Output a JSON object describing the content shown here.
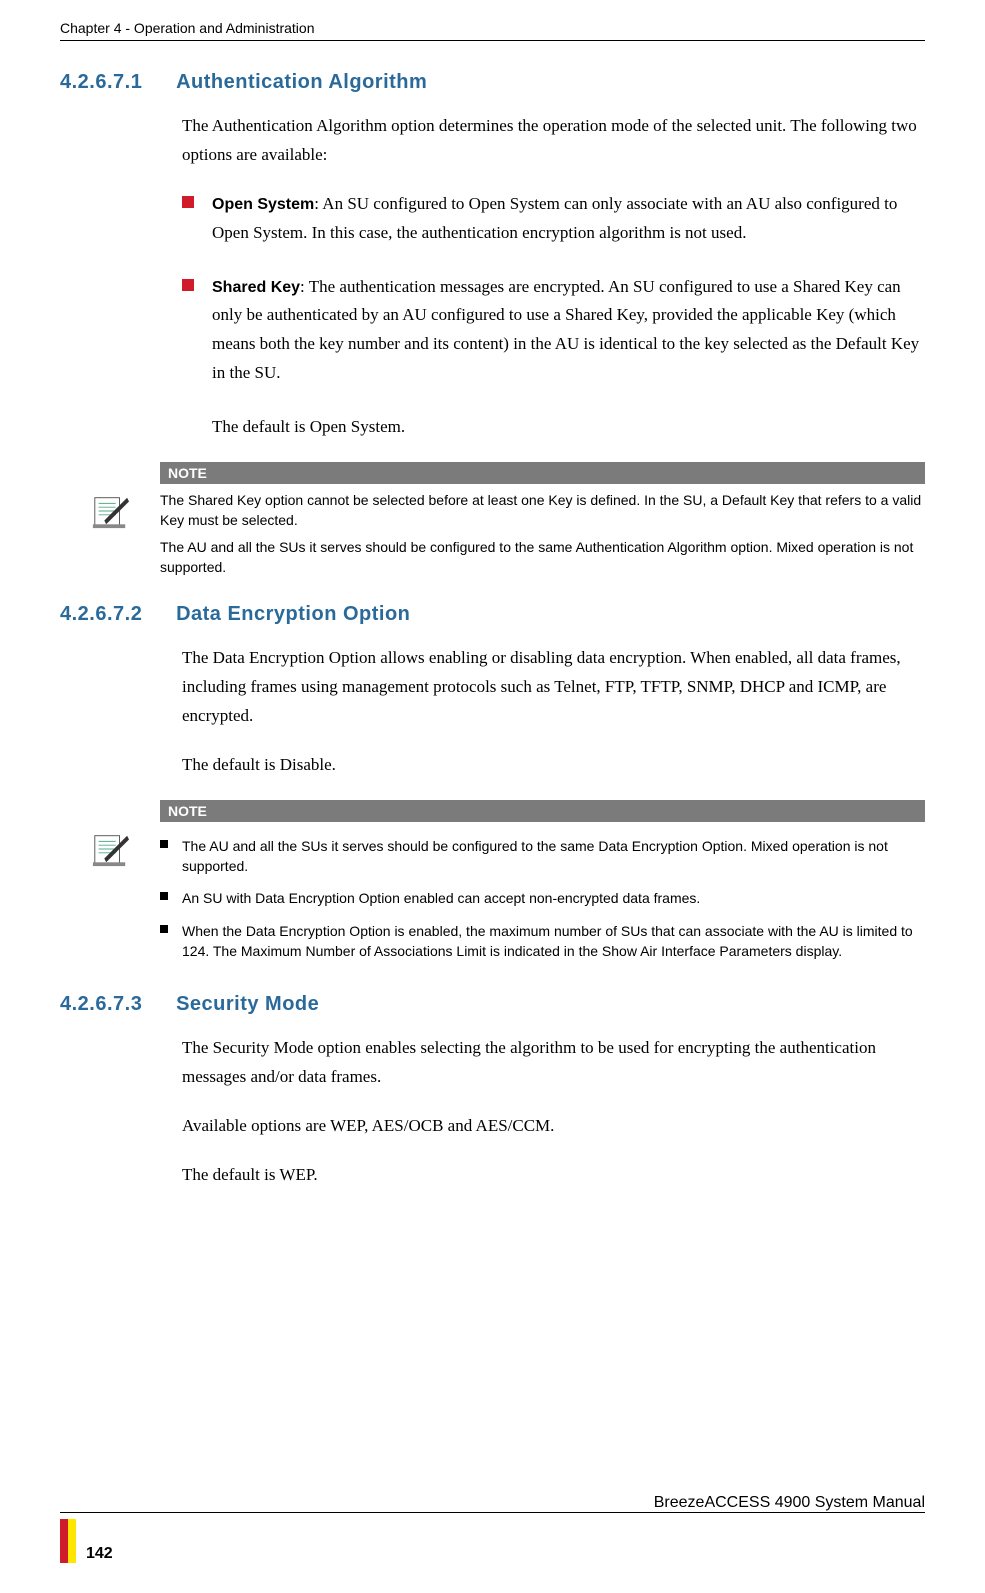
{
  "chapter_header": "Chapter 4 - Operation and Administration",
  "sections": [
    {
      "number": "4.2.6.7.1",
      "title": "Authentication Algorithm",
      "intro": "The Authentication Algorithm option determines the operation mode of the selected unit. The following two options are available:",
      "bullets": [
        {
          "label": "Open System",
          "text": ": An SU configured to Open System can only associate with an AU also configured to Open System. In this case, the authentication encryption algorithm is not used."
        },
        {
          "label": "Shared Key",
          "text": ": The authentication messages are encrypted. An SU configured to use a Shared Key can only be authenticated by an AU configured to use a Shared Key, provided the applicable Key (which means both the key number and its content) in the AU is identical to the key selected as the Default Key in the SU."
        }
      ],
      "default_text": "The default is Open System.",
      "note_label": "NOTE",
      "note_paras": [
        "The Shared Key option cannot be selected before at least one Key is defined. In the SU, a Default Key that refers to a valid Key must be selected.",
        "The AU and all the SUs it serves should be configured to the same Authentication Algorithm option. Mixed operation is not supported."
      ]
    },
    {
      "number": "4.2.6.7.2",
      "title": "Data Encryption Option",
      "intro": "The Data Encryption Option allows enabling or disabling data encryption. When enabled, all data frames, including frames using management protocols such as Telnet, FTP, TFTP, SNMP, DHCP and ICMP, are encrypted.",
      "default_text": "The default is Disable.",
      "note_label": "NOTE",
      "note_bullets": [
        "The AU and all the SUs it serves should be configured to the same Data Encryption Option. Mixed operation is not supported.",
        "An SU with Data Encryption Option enabled can accept non-encrypted data frames.",
        "When the Data Encryption Option is enabled, the maximum number of SUs that can associate with the AU is limited to 124. The Maximum Number of Associations Limit is indicated in the Show Air Interface Parameters display."
      ]
    },
    {
      "number": "4.2.6.7.3",
      "title": "Security Mode",
      "intro": "The Security Mode option enables selecting the algorithm to be used for encrypting the authentication messages and/or data frames.",
      "avail_text": "Available options are WEP, AES/OCB and AES/CCM.",
      "default_text": "The default is WEP."
    }
  ],
  "footer": {
    "page_number": "142",
    "manual": "BreezeACCESS 4900 System Manual"
  }
}
